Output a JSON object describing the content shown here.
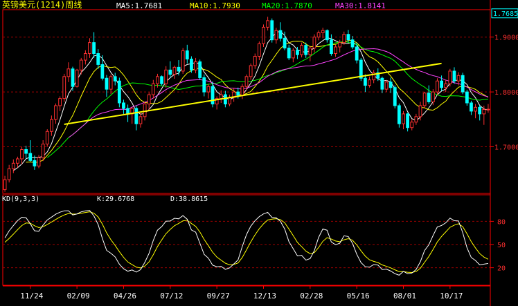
{
  "header": {
    "symbol": "英镑美元(1214)周线",
    "ma": [
      {
        "label": "MA5:1.7681",
        "color": "#ffffff"
      },
      {
        "label": "MA10:1.7930",
        "color": "#ffff00"
      },
      {
        "label": "MA20:1.7870",
        "color": "#00ff00"
      },
      {
        "label": "MA30:1.8141",
        "color": "#ff44ff"
      }
    ]
  },
  "colors": {
    "up": "#ff3030",
    "down": "#00ffff",
    "grid": "#a00000",
    "border": "#ff0000",
    "axis_text": "#ff3030",
    "trendline": "#ffff00",
    "k_line": "#ffffff",
    "d_line": "#ffff00",
    "price_box": "#00ffff"
  },
  "price_axis": {
    "current_price": "1.7685",
    "ticks": [
      {
        "value": 1.9,
        "label": "1.9000"
      },
      {
        "value": 1.8,
        "label": "1.8000"
      },
      {
        "value": 1.7,
        "label": "1.7000"
      }
    ],
    "range": [
      1.615,
      1.95
    ]
  },
  "kd": {
    "label": "KD(9,3,3)",
    "k_label": "K:29.6768",
    "d_label": "D:38.8615",
    "ticks": [
      {
        "value": 80,
        "label": "80"
      },
      {
        "value": 50,
        "label": "50"
      },
      {
        "value": 20,
        "label": "20"
      }
    ],
    "range": [
      0,
      100
    ]
  },
  "x_axis": {
    "labels": [
      "11/24",
      "02/09",
      "04/26",
      "07/12",
      "09/27",
      "12/13",
      "02/28",
      "05/16",
      "08/01",
      "10/17"
    ]
  },
  "chart_data": [
    {
      "type": "candlestick",
      "count": 115,
      "ohlc": [
        [
          1.622,
          1.647,
          1.618,
          1.64
        ],
        [
          1.64,
          1.667,
          1.635,
          1.66
        ],
        [
          1.66,
          1.677,
          1.652,
          1.67
        ],
        [
          1.67,
          1.682,
          1.662,
          1.678
        ],
        [
          1.678,
          1.7,
          1.668,
          1.695
        ],
        [
          1.695,
          1.702,
          1.678,
          1.688
        ],
        [
          1.688,
          1.712,
          1.673,
          1.675
        ],
        [
          1.675,
          1.684,
          1.658,
          1.665
        ],
        [
          1.665,
          1.685,
          1.661,
          1.68
        ],
        [
          1.68,
          1.712,
          1.674,
          1.705
        ],
        [
          1.705,
          1.732,
          1.7,
          1.728
        ],
        [
          1.728,
          1.757,
          1.72,
          1.75
        ],
        [
          1.75,
          1.779,
          1.742,
          1.775
        ],
        [
          1.775,
          1.792,
          1.765,
          1.788
        ],
        [
          1.788,
          1.833,
          1.782,
          1.828
        ],
        [
          1.828,
          1.854,
          1.818,
          1.842
        ],
        [
          1.842,
          1.846,
          1.802,
          1.81
        ],
        [
          1.81,
          1.842,
          1.808,
          1.84
        ],
        [
          1.84,
          1.862,
          1.832,
          1.858
        ],
        [
          1.858,
          1.876,
          1.85,
          1.87
        ],
        [
          1.87,
          1.898,
          1.862,
          1.89
        ],
        [
          1.89,
          1.909,
          1.862,
          1.87
        ],
        [
          1.87,
          1.878,
          1.842,
          1.85
        ],
        [
          1.85,
          1.867,
          1.821,
          1.825
        ],
        [
          1.825,
          1.831,
          1.791,
          1.805
        ],
        [
          1.805,
          1.832,
          1.796,
          1.828
        ],
        [
          1.828,
          1.835,
          1.812,
          1.82
        ],
        [
          1.82,
          1.826,
          1.772,
          1.78
        ],
        [
          1.78,
          1.786,
          1.76,
          1.77
        ],
        [
          1.77,
          1.777,
          1.745,
          1.76
        ],
        [
          1.76,
          1.772,
          1.742,
          1.77
        ],
        [
          1.77,
          1.775,
          1.73,
          1.742
        ],
        [
          1.742,
          1.761,
          1.735,
          1.755
        ],
        [
          1.755,
          1.782,
          1.748,
          1.778
        ],
        [
          1.778,
          1.799,
          1.765,
          1.795
        ],
        [
          1.795,
          1.822,
          1.788,
          1.815
        ],
        [
          1.815,
          1.833,
          1.808,
          1.828
        ],
        [
          1.828,
          1.83,
          1.812,
          1.815
        ],
        [
          1.815,
          1.847,
          1.808,
          1.84
        ],
        [
          1.84,
          1.856,
          1.826,
          1.832
        ],
        [
          1.832,
          1.848,
          1.824,
          1.845
        ],
        [
          1.845,
          1.858,
          1.83,
          1.838
        ],
        [
          1.838,
          1.88,
          1.833,
          1.875
        ],
        [
          1.875,
          1.886,
          1.852,
          1.86
        ],
        [
          1.86,
          1.865,
          1.835,
          1.84
        ],
        [
          1.84,
          1.862,
          1.834,
          1.855
        ],
        [
          1.855,
          1.859,
          1.822,
          1.826
        ],
        [
          1.826,
          1.832,
          1.792,
          1.8
        ],
        [
          1.8,
          1.815,
          1.788,
          1.81
        ],
        [
          1.81,
          1.819,
          1.772,
          1.778
        ],
        [
          1.778,
          1.792,
          1.768,
          1.788
        ],
        [
          1.788,
          1.803,
          1.78,
          1.795
        ],
        [
          1.795,
          1.802,
          1.772,
          1.778
        ],
        [
          1.778,
          1.795,
          1.774,
          1.79
        ],
        [
          1.79,
          1.807,
          1.782,
          1.8
        ],
        [
          1.8,
          1.808,
          1.788,
          1.794
        ],
        [
          1.794,
          1.815,
          1.787,
          1.81
        ],
        [
          1.81,
          1.832,
          1.803,
          1.828
        ],
        [
          1.828,
          1.852,
          1.822,
          1.848
        ],
        [
          1.848,
          1.87,
          1.842,
          1.865
        ],
        [
          1.865,
          1.892,
          1.858,
          1.888
        ],
        [
          1.888,
          1.923,
          1.882,
          1.918
        ],
        [
          1.918,
          1.937,
          1.912,
          1.93
        ],
        [
          1.93,
          1.934,
          1.89,
          1.895
        ],
        [
          1.895,
          1.917,
          1.888,
          1.912
        ],
        [
          1.912,
          1.927,
          1.892,
          1.898
        ],
        [
          1.898,
          1.91,
          1.876,
          1.88
        ],
        [
          1.88,
          1.886,
          1.858,
          1.862
        ],
        [
          1.862,
          1.88,
          1.854,
          1.876
        ],
        [
          1.876,
          1.882,
          1.86,
          1.868
        ],
        [
          1.868,
          1.89,
          1.863,
          1.885
        ],
        [
          1.885,
          1.89,
          1.862,
          1.868
        ],
        [
          1.868,
          1.884,
          1.856,
          1.88
        ],
        [
          1.88,
          1.905,
          1.872,
          1.9
        ],
        [
          1.9,
          1.912,
          1.894,
          1.908
        ],
        [
          1.908,
          1.917,
          1.898,
          1.912
        ],
        [
          1.912,
          1.914,
          1.89,
          1.895
        ],
        [
          1.895,
          1.905,
          1.866,
          1.87
        ],
        [
          1.87,
          1.886,
          1.864,
          1.882
        ],
        [
          1.882,
          1.895,
          1.872,
          1.89
        ],
        [
          1.89,
          1.91,
          1.886,
          1.905
        ],
        [
          1.905,
          1.913,
          1.89,
          1.895
        ],
        [
          1.895,
          1.902,
          1.878,
          1.882
        ],
        [
          1.882,
          1.89,
          1.852,
          1.858
        ],
        [
          1.858,
          1.862,
          1.82,
          1.825
        ],
        [
          1.825,
          1.832,
          1.8,
          1.812
        ],
        [
          1.812,
          1.828,
          1.808,
          1.822
        ],
        [
          1.822,
          1.84,
          1.816,
          1.835
        ],
        [
          1.835,
          1.843,
          1.82,
          1.825
        ],
        [
          1.825,
          1.828,
          1.798,
          1.805
        ],
        [
          1.805,
          1.822,
          1.8,
          1.818
        ],
        [
          1.818,
          1.826,
          1.798,
          1.808
        ],
        [
          1.808,
          1.812,
          1.77,
          1.775
        ],
        [
          1.775,
          1.779,
          1.735,
          1.742
        ],
        [
          1.742,
          1.765,
          1.732,
          1.76
        ],
        [
          1.76,
          1.762,
          1.728,
          1.735
        ],
        [
          1.735,
          1.75,
          1.73,
          1.745
        ],
        [
          1.745,
          1.76,
          1.74,
          1.755
        ],
        [
          1.755,
          1.782,
          1.748,
          1.775
        ],
        [
          1.775,
          1.8,
          1.77,
          1.798
        ],
        [
          1.798,
          1.812,
          1.778,
          1.782
        ],
        [
          1.782,
          1.805,
          1.776,
          1.8
        ],
        [
          1.8,
          1.825,
          1.795,
          1.82
        ],
        [
          1.82,
          1.83,
          1.802,
          1.808
        ],
        [
          1.808,
          1.822,
          1.8,
          1.815
        ],
        [
          1.815,
          1.842,
          1.81,
          1.838
        ],
        [
          1.838,
          1.845,
          1.815,
          1.82
        ],
        [
          1.82,
          1.836,
          1.812,
          1.83
        ],
        [
          1.83,
          1.835,
          1.796,
          1.8
        ],
        [
          1.8,
          1.804,
          1.775,
          1.78
        ],
        [
          1.78,
          1.784,
          1.758,
          1.765
        ],
        [
          1.765,
          1.778,
          1.752,
          1.772
        ],
        [
          1.772,
          1.776,
          1.748,
          1.76
        ],
        [
          1.76,
          1.775,
          1.74,
          1.768
        ],
        [
          1.768,
          1.778,
          1.762,
          1.7685
        ]
      ],
      "moving_averages": [
        5,
        10,
        20,
        30
      ],
      "trendlines": [
        {
          "from": [
            14,
            1.741
          ],
          "to": [
            103,
            1.852
          ]
        }
      ]
    },
    {
      "type": "line",
      "name": "KD(9,3,3)",
      "series": [
        {
          "name": "K",
          "period": 9
        },
        {
          "name": "D",
          "period": 3
        }
      ]
    }
  ]
}
